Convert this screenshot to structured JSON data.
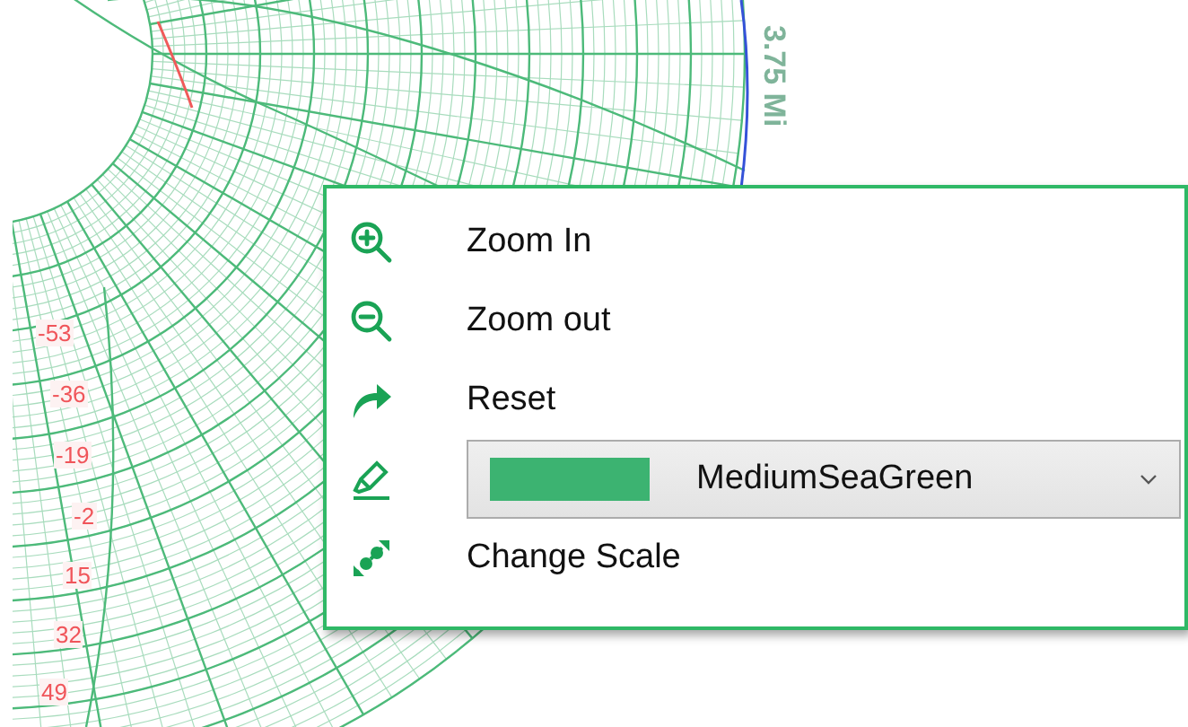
{
  "chart": {
    "axis_label": "3.75 Mi",
    "scale_labels": [
      "-53",
      "-36",
      "-19",
      "-2",
      "15",
      "32",
      "49"
    ]
  },
  "context_menu": {
    "items": [
      {
        "kind": "command",
        "label": "Zoom In"
      },
      {
        "kind": "command",
        "label": "Zoom out"
      },
      {
        "kind": "command",
        "label": "Reset"
      },
      {
        "kind": "color-picker",
        "color": "#3cb371",
        "value": "MediumSeaGreen"
      },
      {
        "kind": "command",
        "label": "Change Scale"
      }
    ]
  }
}
